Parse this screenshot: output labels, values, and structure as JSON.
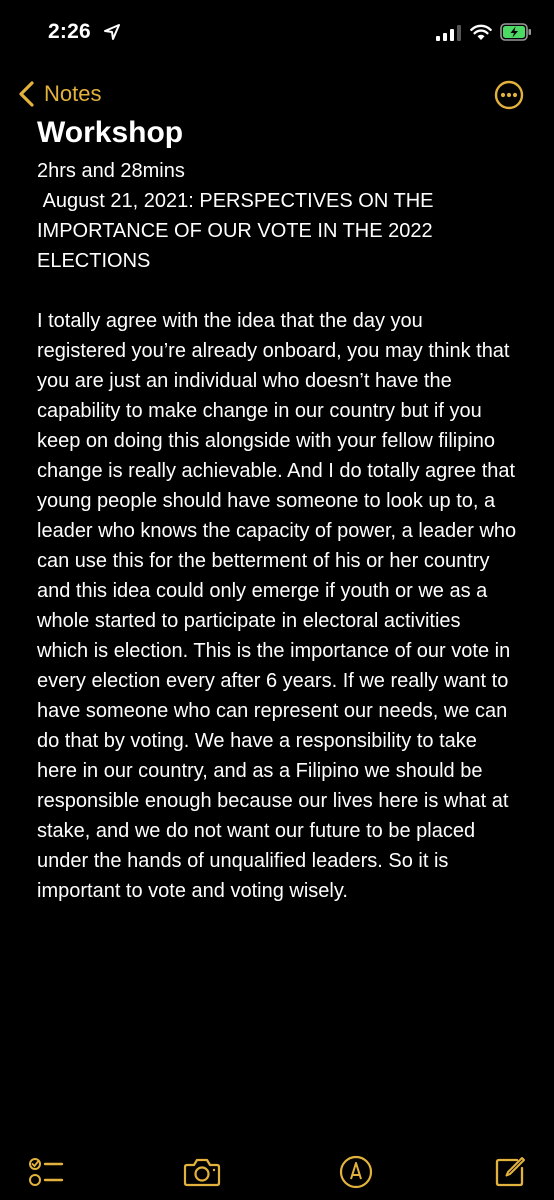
{
  "status_bar": {
    "time": "2:26"
  },
  "nav": {
    "back_label": "Notes",
    "title": "Notes"
  },
  "note": {
    "heading": "Workshop",
    "duration": "2hrs and 28mins",
    "date_title": " August 21, 2021: PERSPECTIVES ON THE IMPORTANCE OF OUR VOTE IN THE 2022 ELECTIONS",
    "body": "I totally agree with the idea that the day you registered you’re already onboard, you may think that you are just an individual who doesn’t have the capability to make change in our country but if you keep on doing this alongside with your fellow filipino change is really achievable. And I do totally agree that young people should have someone to look up to, a leader who knows the capacity of power, a leader who can use this for the betterment of his or her country and this idea could only emerge if youth or we as a whole started to participate in electoral activities which is election. This is the importance of our vote in every election every after 6 years. If we really want to have someone who can represent our needs, we can do that by voting. We have a responsibility to take here in our country, and as a Filipino we should be responsible enough because our lives here is what at stake, and we do not want our future to be placed under the hands of unqualified leaders. So it is important to vote and voting wisely."
  },
  "colors": {
    "accent": "#e3b23c",
    "background": "#000000",
    "text": "#ffffff",
    "battery": "#4cd964"
  },
  "icons": {
    "location": "location-arrow-icon",
    "signal": "cellular-signal-icon",
    "wifi": "wifi-icon",
    "battery": "battery-charging-icon",
    "back": "chevron-left-icon",
    "more": "ellipsis-circle-icon",
    "checklist": "checklist-icon",
    "camera": "camera-icon",
    "markup": "markup-pen-icon",
    "compose": "compose-icon"
  }
}
